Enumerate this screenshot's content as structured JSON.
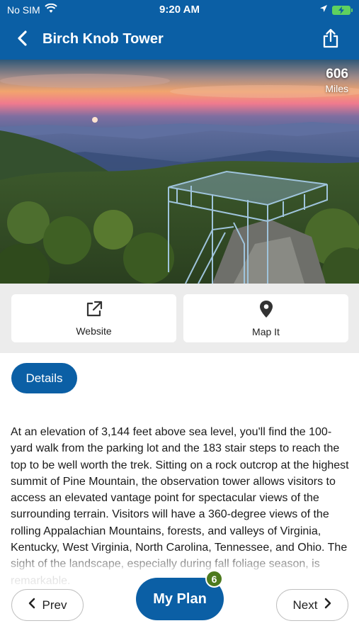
{
  "status_bar": {
    "carrier": "No SIM",
    "time": "9:20 AM",
    "icons": [
      "wifi-icon",
      "location-arrow-icon",
      "battery-charging-icon"
    ]
  },
  "nav": {
    "title": "Birch Knob Tower",
    "back_icon": "chevron-left-icon",
    "share_icon": "share-icon"
  },
  "hero": {
    "distance_value": "606",
    "distance_unit": "Miles"
  },
  "actions": [
    {
      "label": "Website",
      "icon": "external-link-icon"
    },
    {
      "label": "Map It",
      "icon": "map-pin-icon"
    }
  ],
  "tabs": {
    "details_label": "Details"
  },
  "description": "At an elevation of 3,144 feet above sea level, you'll find the 100-yard walk from the parking lot and the 183 stair steps to reach the top to be well worth the trek. Sitting on a rock outcrop at the highest summit of Pine Mountain, the observation tower allows visitors to access an elevated vantage point for spectacular views of the surrounding terrain. Visitors will have a 360-degree views of the rolling Appalachian Mountains, forests, and valleys of Virginia, Kentucky, West Virginia, North Carolina, Tennessee, and Ohio. The sight of the landscape, especially during fall foliage season, is remarkable.",
  "footer": {
    "prev_label": "Prev",
    "next_label": "Next",
    "my_plan_label": "My Plan",
    "plan_count": "6"
  },
  "colors": {
    "brand_blue": "#0b5fa5",
    "badge_green": "#4d7a1e",
    "actions_bg": "#ececec"
  }
}
